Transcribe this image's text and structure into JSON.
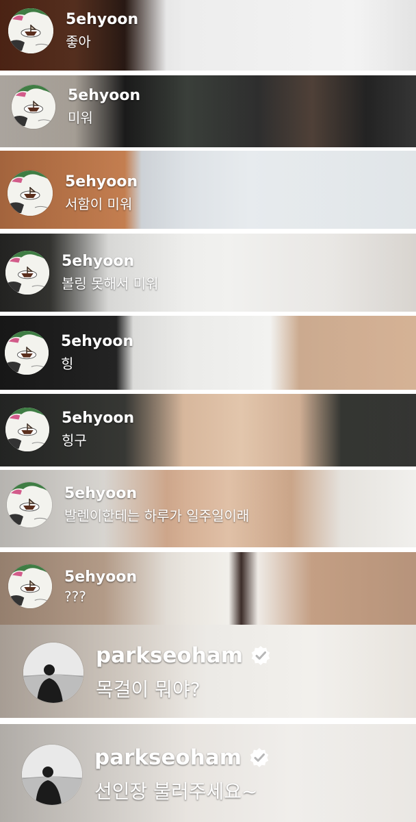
{
  "comments": [
    {
      "username": "5ehyoon",
      "message": "좋아",
      "verified": false
    },
    {
      "username": "5ehyoon",
      "message": "미워",
      "verified": false
    },
    {
      "username": "5ehyoon",
      "message": "서함이 미워",
      "verified": false
    },
    {
      "username": "5ehyoon",
      "message": "볼링 못해서 미워",
      "verified": false
    },
    {
      "username": "5ehyoon",
      "message": "힝",
      "verified": false
    },
    {
      "username": "5ehyoon",
      "message": "힝구",
      "verified": false
    },
    {
      "username": "5ehyoon",
      "message": "발렌이한테는 하루가 일주일이래",
      "verified": false
    },
    {
      "username": "5ehyoon",
      "message": "???",
      "verified": false
    },
    {
      "username": "parkseoham",
      "message": "목걸이 뭐야?",
      "verified": true
    },
    {
      "username": "parkseoham",
      "message": "선인장 불러주세요~",
      "verified": true
    }
  ],
  "colors": {
    "text": "#ffffff",
    "separator": "#ffffff",
    "verified_badge": "#ffffff"
  },
  "icons": {
    "avatar_1": "illustrated-boat-avatar-icon",
    "avatar_2": "silhouette-photo-avatar-icon",
    "verified": "verified-badge-icon"
  }
}
